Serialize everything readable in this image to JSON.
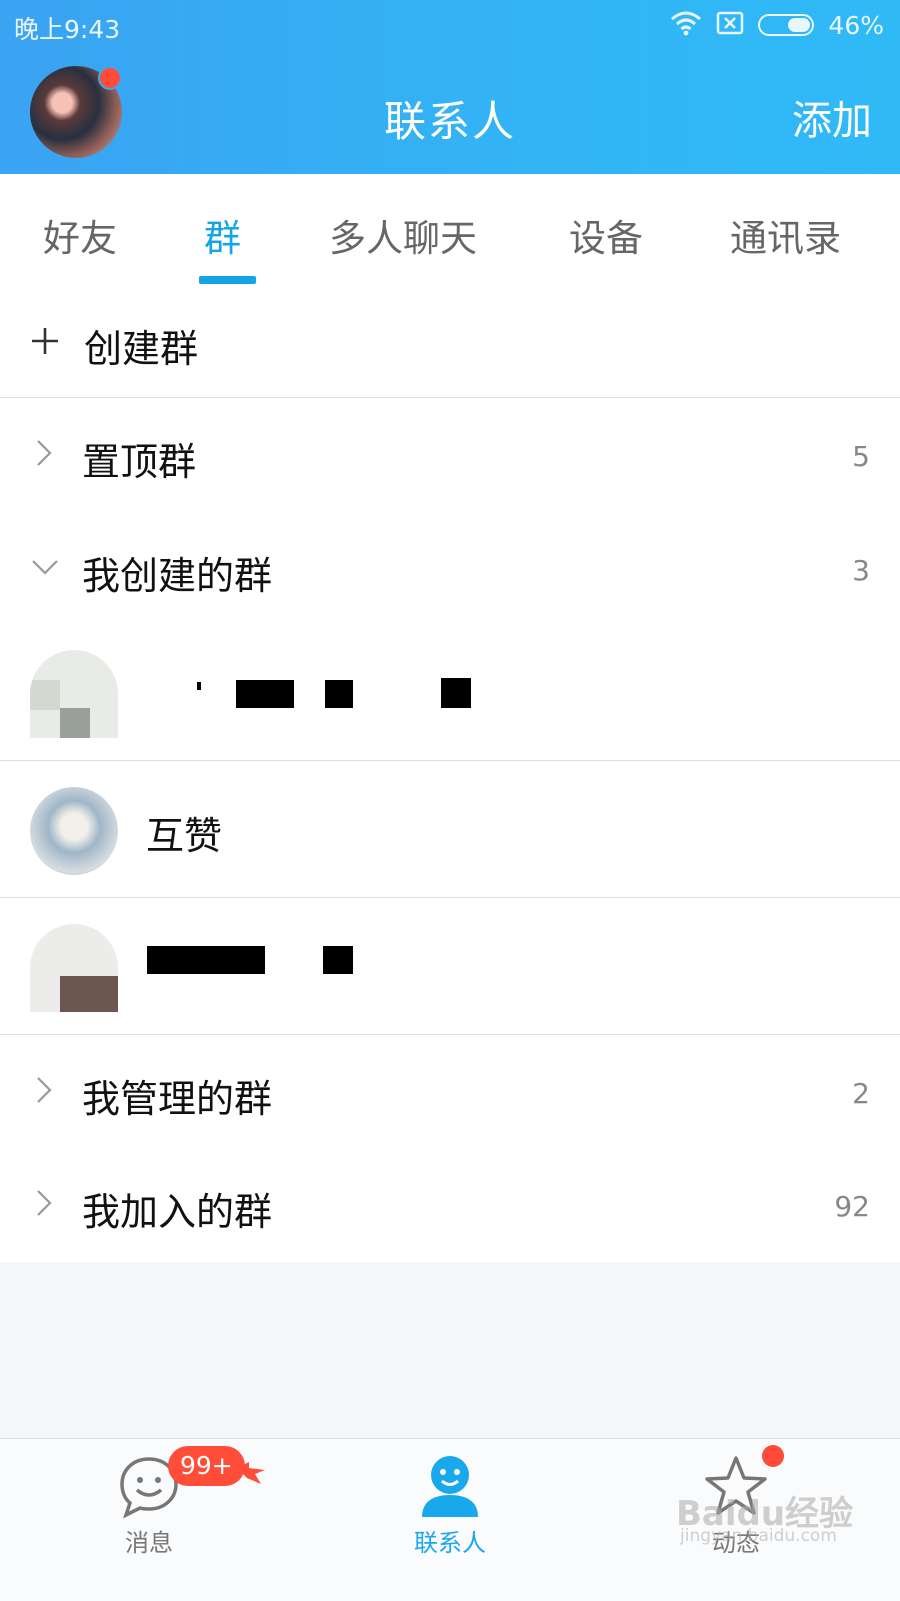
{
  "status_bar": {
    "time": "晚上9:43",
    "battery": "46%",
    "battery_fraction": 0.46
  },
  "header": {
    "title": "联系人",
    "add_label": "添加"
  },
  "tabs": [
    {
      "label": "好友",
      "active": false
    },
    {
      "label": "群",
      "active": true
    },
    {
      "label": "多人聊天",
      "active": false
    },
    {
      "label": "设备",
      "active": false
    },
    {
      "label": "通讯录",
      "active": false
    }
  ],
  "create_group": {
    "label": "创建群"
  },
  "sections": {
    "pinned": {
      "label": "置顶群",
      "count": "5",
      "expanded": false
    },
    "created": {
      "label": "我创建的群",
      "count": "3",
      "expanded": true
    },
    "managed": {
      "label": "我管理的群",
      "count": "2",
      "expanded": false
    },
    "joined": {
      "label": "我加入的群",
      "count": "92",
      "expanded": false
    }
  },
  "groups": [
    {
      "name": "",
      "redacted": true
    },
    {
      "name": "互赞",
      "redacted": false
    },
    {
      "name": "",
      "redacted": true
    }
  ],
  "bottom_nav": {
    "messages": {
      "label": "消息",
      "badge": "99+"
    },
    "contacts": {
      "label": "联系人",
      "active": true
    },
    "moments": {
      "label": "动态",
      "has_dot": true
    }
  },
  "watermark": {
    "text": "Baidu经验",
    "sub": "jingyan.baidu.com"
  },
  "colors": {
    "header": "#33b3f5",
    "accent": "#14a5e6",
    "badge": "#ff4d3a"
  }
}
